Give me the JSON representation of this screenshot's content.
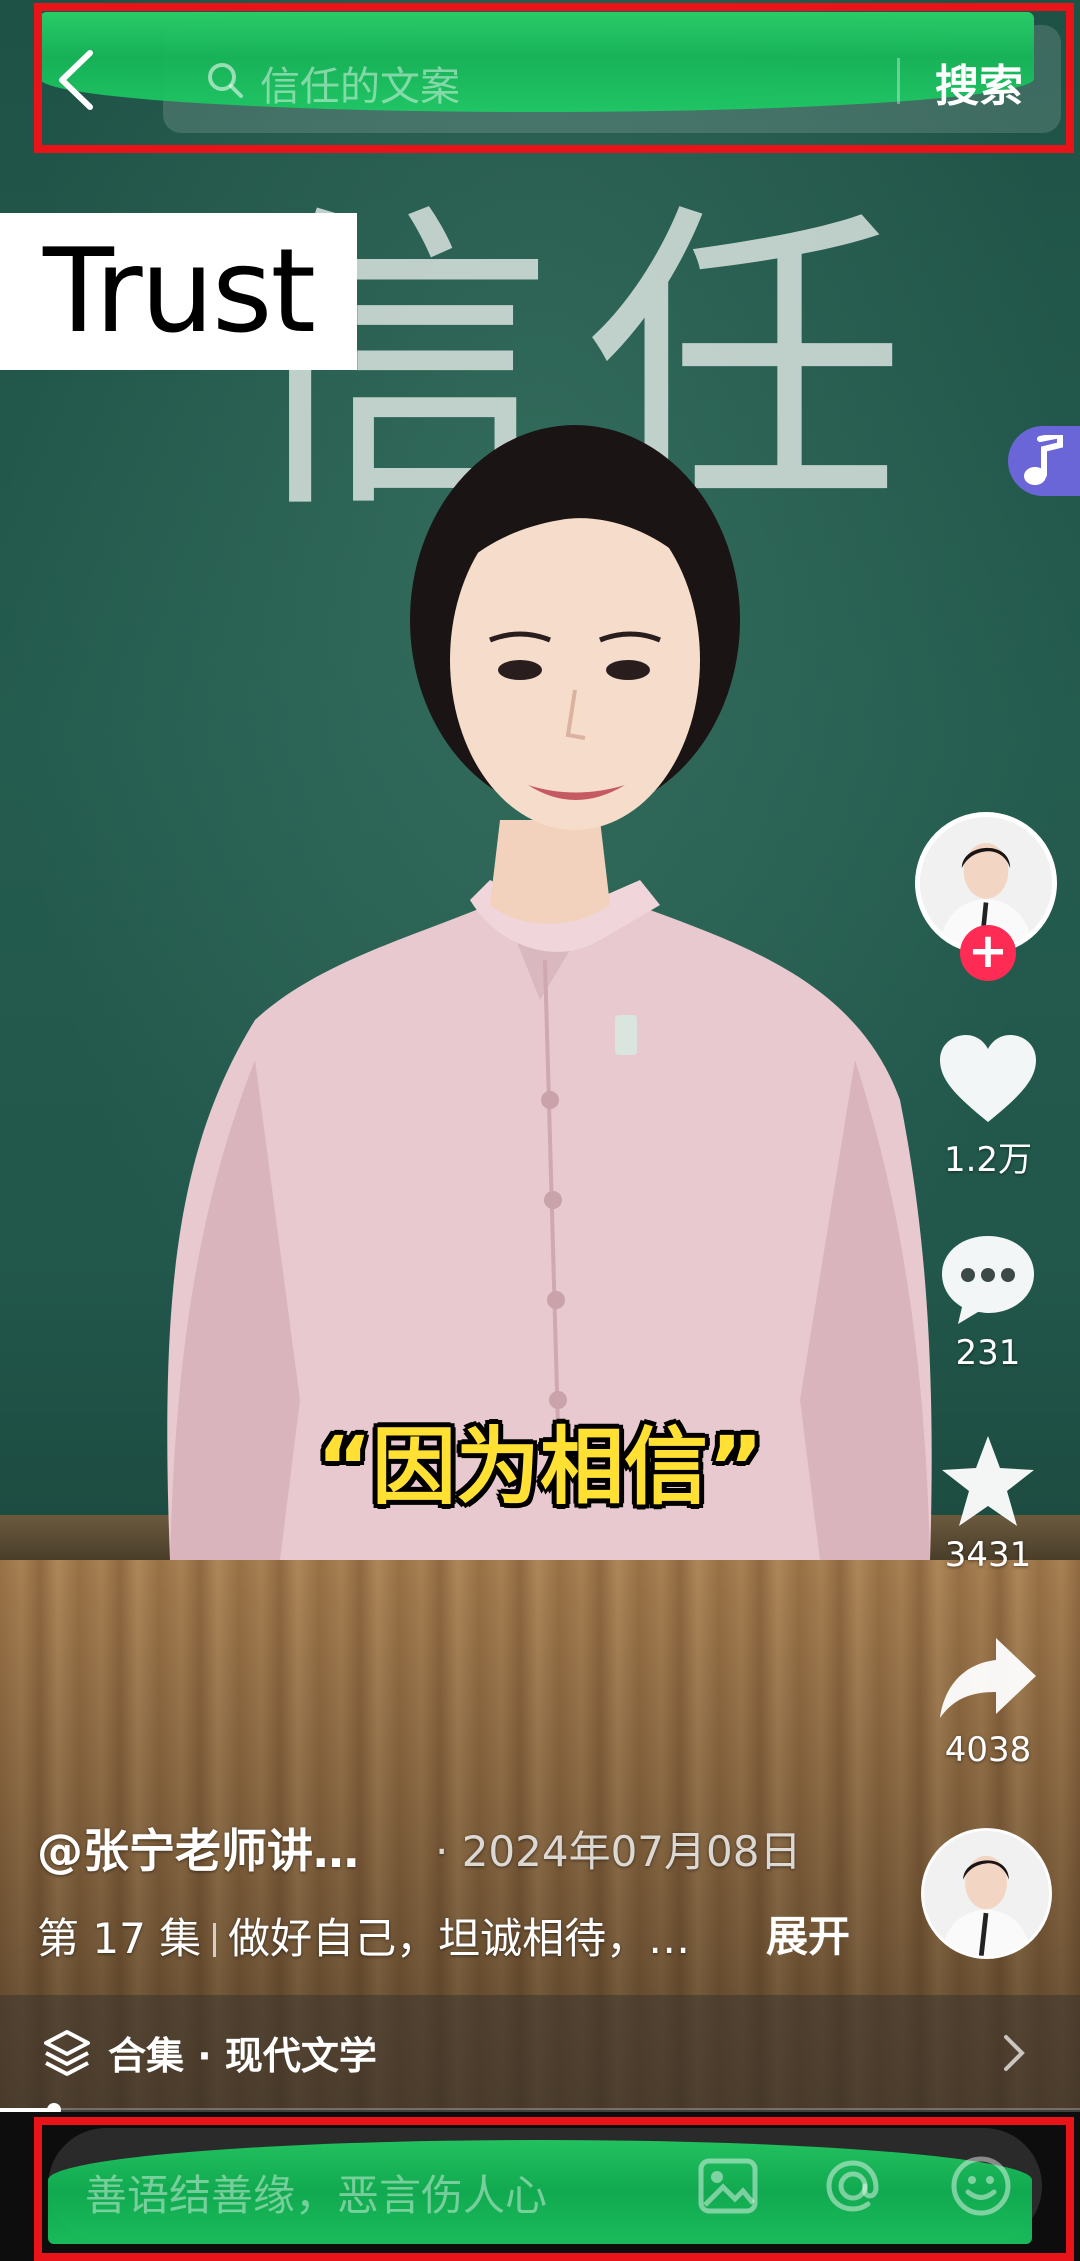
{
  "search": {
    "placeholder": "信任的文案",
    "button_label": "搜索"
  },
  "video": {
    "chalk_chars": [
      "信",
      "任"
    ],
    "overlay_label": "Trust",
    "caption": "“因为相信”"
  },
  "actions": {
    "likes": "1.2万",
    "comments": "231",
    "favorites": "3431",
    "shares": "4038"
  },
  "info": {
    "author": "@张宁老师讲…",
    "date": "· 2024年07月08日",
    "episode": "第 17 集",
    "description": "做好自己，坦诚相待，…",
    "expand_label": "展开"
  },
  "collection": {
    "label": "合集 · 现代文学"
  },
  "progress": {
    "fraction": 0.05
  },
  "comment": {
    "placeholder": "善语结善缘，恶言伤人心"
  },
  "colors": {
    "follow_red": "#fe2c55",
    "caption_yellow": "#ffe033",
    "music_badge": "#6a66d8",
    "annotation_red": "#e8141a",
    "mask_green": "#16b558"
  }
}
